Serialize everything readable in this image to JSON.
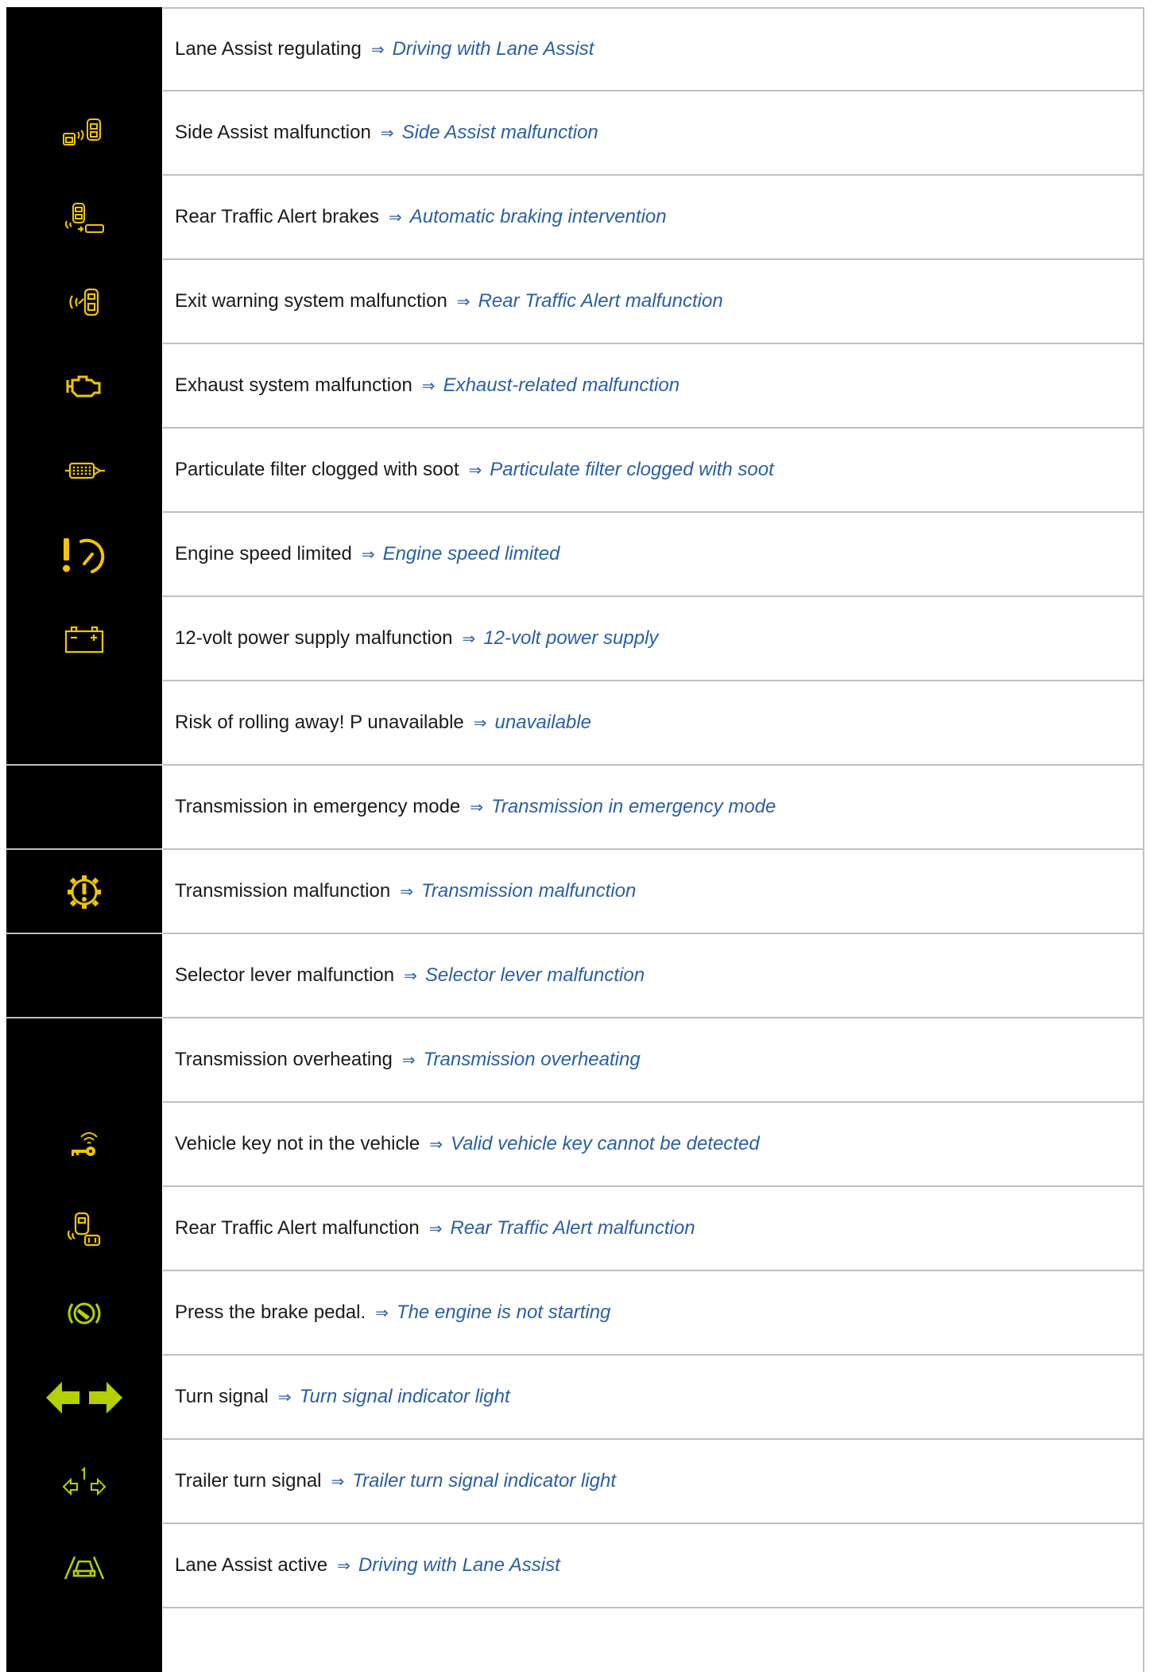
{
  "rows": [
    {
      "text": "Lane Assist regulating",
      "link": "Driving with Lane Assist",
      "icon": "none"
    },
    {
      "text": "Side Assist malfunction",
      "link": "Side Assist malfunction",
      "icon": "side-assist-icon"
    },
    {
      "text": "Rear Traffic Alert brakes",
      "link": "Automatic braking intervention",
      "icon": "rear-traffic-alert-brake-icon"
    },
    {
      "text": "Exit warning system malfunction",
      "link": "Rear Traffic Alert malfunction",
      "icon": "exit-warning-icon"
    },
    {
      "text": "Exhaust system malfunction",
      "link": "Exhaust-related malfunction",
      "icon": "engine-icon"
    },
    {
      "text": "Particulate filter clogged with soot",
      "link": "Particulate filter clogged with soot",
      "icon": "particulate-filter-icon"
    },
    {
      "text": "Engine speed limited",
      "link": "Engine speed limited",
      "icon": "engine-speed-limited-icon"
    },
    {
      "text": "12-volt power supply malfunction",
      "link": "12-volt power supply",
      "icon": "battery-icon"
    },
    {
      "text": "Risk of rolling away! P unavailable",
      "link": "unavailable",
      "icon": "transmission-icon"
    },
    {
      "text": "Transmission in emergency mode",
      "link": "Transmission in emergency mode",
      "icon": "transmission-icon"
    },
    {
      "text": "Transmission malfunction",
      "link": "Transmission malfunction",
      "icon": "transmission-icon"
    },
    {
      "text": "Selector lever malfunction",
      "link": "Selector lever malfunction",
      "icon": "transmission-icon"
    },
    {
      "text": "Transmission overheating",
      "link": "Transmission overheating",
      "icon": "transmission-icon"
    },
    {
      "text": "Vehicle key not in the vehicle",
      "link": "Valid vehicle key cannot be detected",
      "icon": "vehicle-key-icon"
    },
    {
      "text": "Rear Traffic Alert malfunction",
      "link": "Rear Traffic Alert malfunction",
      "icon": "rear-traffic-alert-icon"
    },
    {
      "text": "Press the brake pedal.",
      "link": "The engine is not starting",
      "icon": "brake-pedal-icon"
    },
    {
      "text": "Turn signal",
      "link": "Turn signal indicator light",
      "icon": "turn-signal-icon"
    },
    {
      "text": "Trailer turn signal",
      "link": "Trailer turn signal indicator light",
      "icon": "trailer-turn-signal-icon"
    },
    {
      "text": "Lane Assist active",
      "link": "Driving with Lane Assist",
      "icon": "lane-assist-icon"
    }
  ],
  "arrow_glyph": "⇒",
  "colors": {
    "icon_yellow": "#f2c500",
    "icon_green": "#b5d000",
    "link_blue": "#2a5fa3",
    "cell_black": "#000000",
    "border_gray": "#bfbfbf"
  }
}
